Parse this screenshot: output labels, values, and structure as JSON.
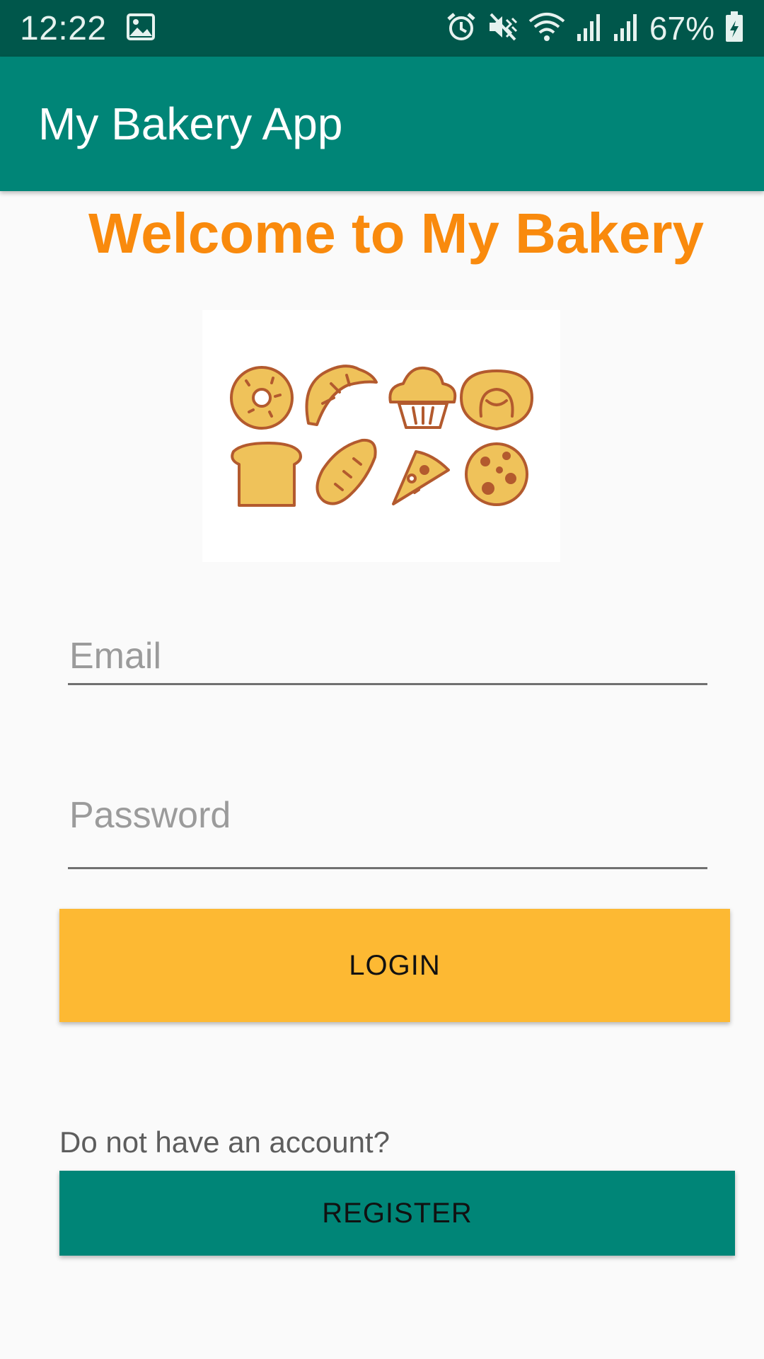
{
  "status_bar": {
    "time": "12:22",
    "battery_text": "67%",
    "icons": [
      "image-icon",
      "alarm-icon",
      "mute-vibrate-icon",
      "wifi-icon",
      "signal-icon",
      "signal-icon",
      "battery-charging-icon"
    ]
  },
  "app_bar": {
    "title": "My Bakery App"
  },
  "main": {
    "welcome": "Welcome to My Bakery",
    "logo_icons": [
      "donut-icon",
      "croissant-icon",
      "muffin-icon",
      "pretzel-icon",
      "bread-icon",
      "loaf-icon",
      "pizza-slice-icon",
      "cookie-icon"
    ],
    "email_placeholder": "Email",
    "password_placeholder": "Password",
    "login_label": "LOGIN",
    "no_account_text": "Do not have an account?",
    "register_label": "REGISTER"
  },
  "colors": {
    "status_bar": "#00574b",
    "app_bar": "#008577",
    "accent_orange": "#f98a0d",
    "login_button": "#fdb933",
    "register_button": "#008577",
    "icon_fill": "#efc25a",
    "icon_stroke": "#b35a2e"
  }
}
